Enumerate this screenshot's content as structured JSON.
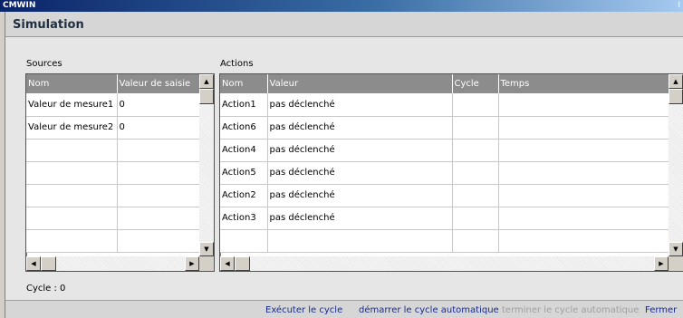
{
  "window": {
    "title": "CMWIN",
    "title_right": "I"
  },
  "header": {
    "title": "Simulation"
  },
  "sources": {
    "label": "Sources",
    "columns": [
      "Nom",
      "Valeur de saisie"
    ],
    "rows": [
      [
        "Valeur de mesure1",
        "0"
      ],
      [
        "Valeur de mesure2",
        "0"
      ],
      [
        "",
        ""
      ],
      [
        "",
        ""
      ],
      [
        "",
        ""
      ],
      [
        "",
        ""
      ],
      [
        "",
        ""
      ]
    ]
  },
  "actions": {
    "label": "Actions",
    "columns": [
      "Nom",
      "Valeur",
      "Cycle",
      "Temps"
    ],
    "rows": [
      [
        "Action1",
        "pas déclenché",
        "",
        ""
      ],
      [
        "Action6",
        "pas déclenché",
        "",
        ""
      ],
      [
        "Action4",
        "pas déclenché",
        "",
        ""
      ],
      [
        "Action5",
        "pas déclenché",
        "",
        ""
      ],
      [
        "Action2",
        "pas déclenché",
        "",
        ""
      ],
      [
        "Action3",
        "pas déclenché",
        "",
        ""
      ],
      [
        "",
        "",
        "",
        ""
      ]
    ]
  },
  "status": {
    "cycle": "Cycle : 0"
  },
  "footer": {
    "execute": "Exécuter le cycle",
    "start_auto": "démarrer le cycle automatique",
    "stop_auto": "terminer le cycle automatique",
    "close": "Fermer"
  },
  "icons": {
    "scroll_up": "up-arrow-icon",
    "scroll_down": "down-arrow-icon",
    "scroll_left": "left-arrow-icon",
    "scroll_right": "right-arrow-icon"
  }
}
